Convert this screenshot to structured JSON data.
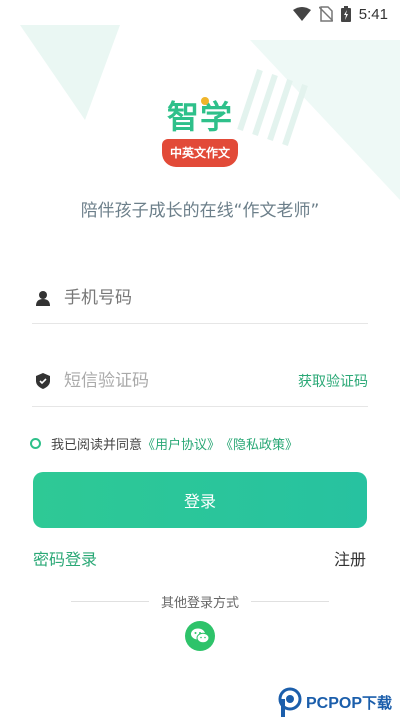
{
  "status_bar": {
    "time": "5:41"
  },
  "logo": {
    "main_text": "智学",
    "badge_text": "中英文作文"
  },
  "tagline": "陪伴孩子成长的在线“作文老师”",
  "phone_field": {
    "placeholder": "手机号码",
    "icon": "user-icon"
  },
  "code_field": {
    "placeholder": "短信验证码",
    "icon": "shield-icon",
    "get_code_label": "获取验证码"
  },
  "agreement": {
    "prefix": "我已阅读并同意",
    "user_agreement": "《用户协议》",
    "privacy_policy": "《隐私政策》"
  },
  "login_button": "登录",
  "password_login": "密码登录",
  "register": "注册",
  "other_login_label": "其他登录方式",
  "watermark": {
    "brand": "PCPOP",
    "suffix": "下载"
  },
  "colors": {
    "accent": "#2ec08a",
    "link": "#2aa876",
    "badge": "#e24a38",
    "wechat": "#2ec36a"
  }
}
